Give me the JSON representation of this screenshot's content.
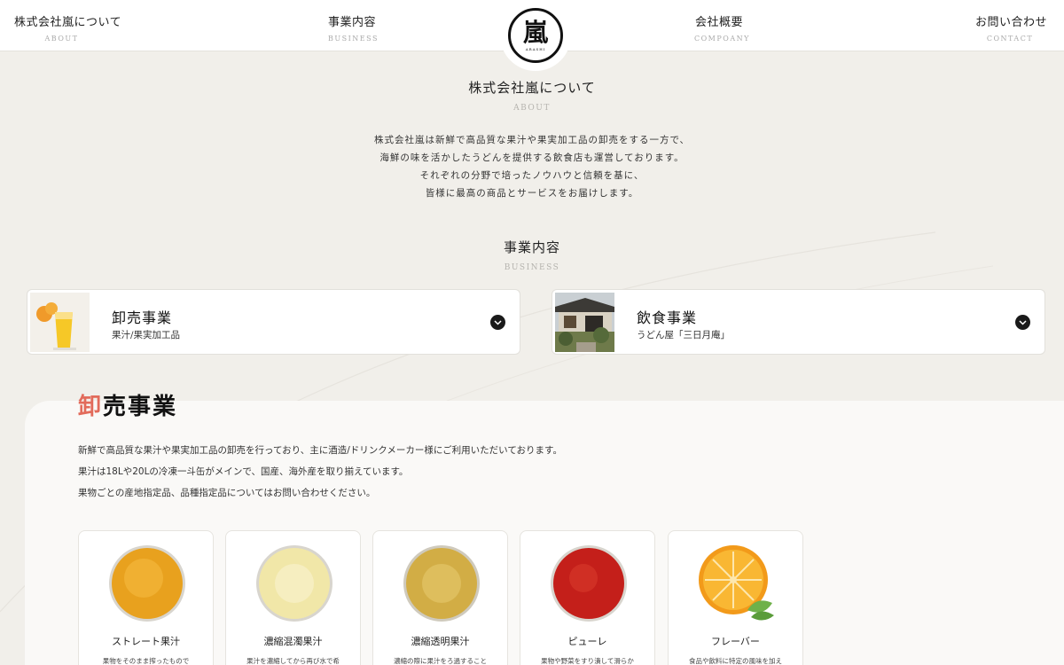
{
  "nav": {
    "items": [
      {
        "jp": "株式会社嵐について",
        "en": "ABOUT"
      },
      {
        "jp": "事業内容",
        "en": "BUSINESS"
      },
      {
        "jp": "会社概要",
        "en": "COMPOANY"
      },
      {
        "jp": "お問い合わせ",
        "en": "CONTACT"
      }
    ],
    "logo": {
      "kanji": "嵐",
      "roman": "ARASHI"
    }
  },
  "about": {
    "title": "株式会社嵐について",
    "title_en": "ABOUT",
    "lines": [
      "株式会社嵐は新鮮で高品質な果汁や果実加工品の卸売をする一方で、",
      "海鮮の味を活かしたうどんを提供する飲食店も運営しております。",
      "それぞれの分野で培ったノウハウと信頼を基に、",
      "皆様に最高の商品とサービスをお届けします。"
    ]
  },
  "business": {
    "title": "事業内容",
    "title_en": "BUSINESS",
    "cards": [
      {
        "title": "卸売事業",
        "sub": "果汁/果実加工品",
        "icon": "chevron-down-icon"
      },
      {
        "title": "飲食事業",
        "sub": "うどん屋「三日月庵」",
        "icon": "chevron-down-icon"
      }
    ]
  },
  "wholesale": {
    "heading_accent": "卸",
    "heading_rest": "売事業",
    "desc": [
      "新鮮で高品質な果汁や果実加工品の卸売を行っており、主に酒造/ドリンクメーカー様にご利用いただいております。",
      "果汁は18Lや20Lの冷凍一斗缶がメインで、国産、海外産を取り揃えています。",
      "果物ごとの産地指定品、品種指定品についてはお問い合わせください。"
    ],
    "products": [
      {
        "name": "ストレート果汁",
        "desc": "果物をそのまま搾ったもので",
        "color": "#f2a31d"
      },
      {
        "name": "濃縮混濁果汁",
        "desc": "果汁を濃縮してから再び水で希",
        "color": "#f3eab0"
      },
      {
        "name": "濃縮透明果汁",
        "desc": "濃縮の際に果汁をろ過すること",
        "color": "#d9b244"
      },
      {
        "name": "ピューレ",
        "desc": "果物や野菜をすり潰して滑らか",
        "color": "#c9231e"
      },
      {
        "name": "フレーバー",
        "desc": "食品や飲料に特定の風味を加え",
        "color": "#f08c14"
      }
    ]
  },
  "colors": {
    "accent": "#e26b5b",
    "background": "#f1efea"
  }
}
